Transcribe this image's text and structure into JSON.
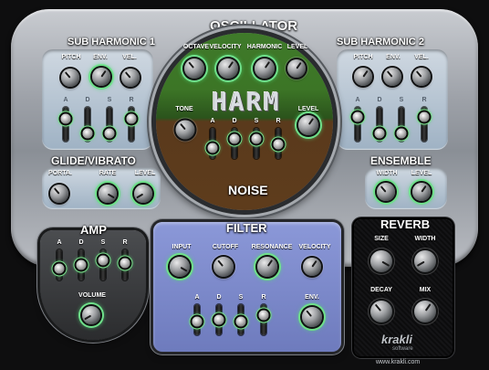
{
  "app": {
    "brand_name": "krakli",
    "brand_sub": "software",
    "url": "www.krakli.com",
    "logo_text": "HARM"
  },
  "colors": {
    "osc_green": "#3f7a2a",
    "noise_brown": "#5a3a1c",
    "filter_blue": "#7c89c8",
    "accent_green": "#6fe08a"
  },
  "oscillator": {
    "title": "OSCILLATOR",
    "labels": [
      "OCTAVE",
      "VELOCITY",
      "HARMONIC",
      "LEVEL"
    ]
  },
  "noise": {
    "title": "NOISE",
    "tone": "TONE",
    "level": "LEVEL",
    "adsr": [
      "A",
      "D",
      "S",
      "R"
    ]
  },
  "sub1": {
    "title": "SUB HARMONIC 1",
    "labels": [
      "PITCH",
      "ENV.",
      "VEL."
    ],
    "adsr": [
      "A",
      "D",
      "S",
      "R"
    ]
  },
  "sub2": {
    "title": "SUB HARMONIC 2",
    "labels": [
      "PITCH",
      "ENV.",
      "VEL."
    ],
    "adsr": [
      "A",
      "D",
      "S",
      "R"
    ]
  },
  "glide": {
    "title": "GLIDE/VIBRATO",
    "labels": [
      "PORTA.",
      "RATE",
      "LEVEL"
    ]
  },
  "ensemble": {
    "title": "ENSEMBLE",
    "labels": [
      "WIDTH",
      "LEVEL"
    ]
  },
  "amp": {
    "title": "AMP",
    "adsr": [
      "A",
      "D",
      "S",
      "R"
    ],
    "volume": "VOLUME"
  },
  "filter": {
    "title": "FILTER",
    "labels": [
      "INPUT",
      "CUTOFF",
      "RESONANCE",
      "VELOCITY"
    ],
    "adsr": [
      "A",
      "D",
      "S",
      "R"
    ],
    "env": "ENV."
  },
  "reverb": {
    "title": "REVERB",
    "labels": [
      "SIZE",
      "WIDTH",
      "DECAY",
      "MIX"
    ]
  }
}
